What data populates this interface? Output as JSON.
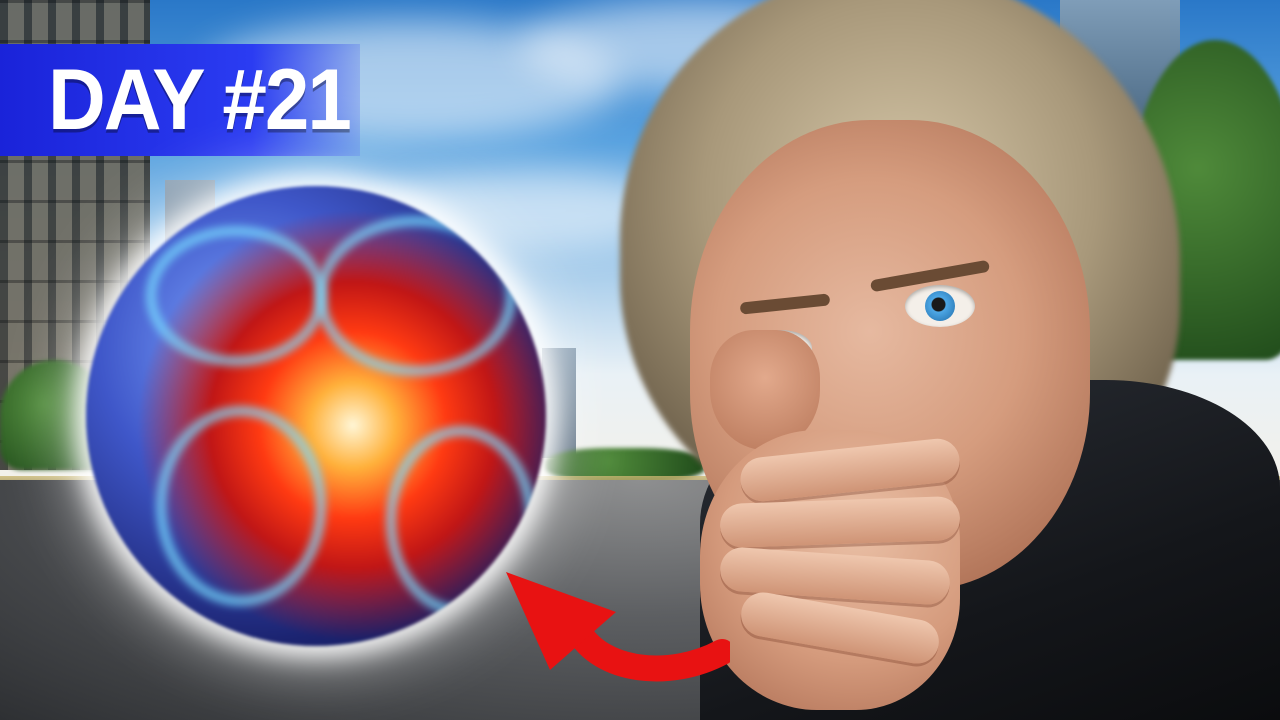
{
  "banner": {
    "text": "DAY #21",
    "background_color": "#2b3cf2",
    "text_color": "#ffffff"
  },
  "arrow": {
    "color": "#e81212",
    "icon": "curved-arrow-icon"
  }
}
